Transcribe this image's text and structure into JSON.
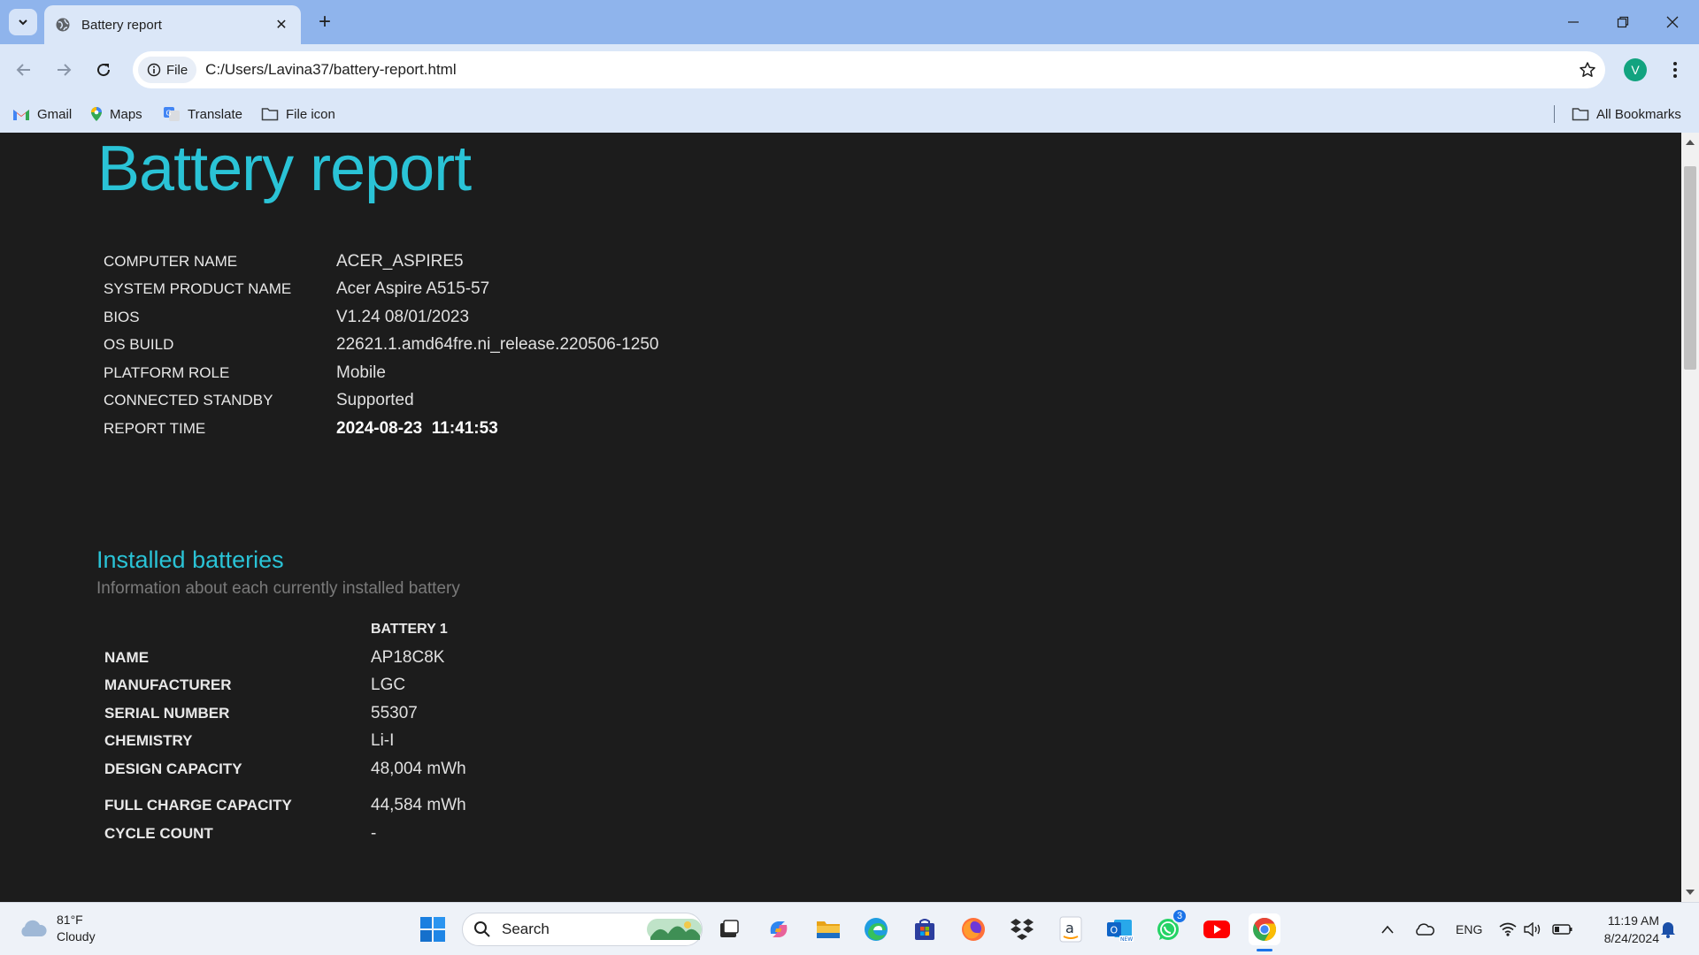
{
  "browser": {
    "tab_title": "Battery report",
    "file_chip": "File",
    "url": "C:/Users/Lavina37/battery-report.html",
    "profile_initial": "V",
    "bookmarks": [
      {
        "label": "Gmail",
        "icon": "gmail-icon"
      },
      {
        "label": "Maps",
        "icon": "maps-icon"
      },
      {
        "label": "Translate",
        "icon": "translate-icon"
      },
      {
        "label": "File icon",
        "icon": "folder-icon"
      }
    ],
    "all_bookmarks": "All Bookmarks"
  },
  "report": {
    "title": "Battery report",
    "system_info": [
      {
        "key": "COMPUTER NAME",
        "value": "ACER_ASPIRE5"
      },
      {
        "key": "SYSTEM PRODUCT NAME",
        "value": "Acer Aspire A515-57"
      },
      {
        "key": "BIOS",
        "value": "V1.24 08/01/2023"
      },
      {
        "key": "OS BUILD",
        "value": "22621.1.amd64fre.ni_release.220506-1250"
      },
      {
        "key": "PLATFORM ROLE",
        "value": "Mobile"
      },
      {
        "key": "CONNECTED STANDBY",
        "value": "Supported"
      },
      {
        "key": "REPORT TIME",
        "value": "2024-08-23  11:41:53"
      }
    ],
    "installed": {
      "heading": "Installed batteries",
      "subtitle": "Information about each currently installed battery",
      "column_header": "BATTERY 1",
      "rows": [
        {
          "key": "NAME",
          "value": "AP18C8K"
        },
        {
          "key": "MANUFACTURER",
          "value": "LGC"
        },
        {
          "key": "SERIAL NUMBER",
          "value": "55307"
        },
        {
          "key": "CHEMISTRY",
          "value": "Li-I"
        },
        {
          "key": "DESIGN CAPACITY",
          "value": "48,004 mWh"
        },
        {
          "key": "FULL CHARGE CAPACITY",
          "value": "44,584 mWh"
        },
        {
          "key": "CYCLE COUNT",
          "value": "-"
        }
      ]
    }
  },
  "taskbar": {
    "weather_temp": "81°F",
    "weather_desc": "Cloudy",
    "search_label": "Search",
    "whatsapp_badge": "3",
    "lang": "ENG",
    "time": "11:19 AM",
    "date": "8/24/2024"
  },
  "colors": {
    "accent": "#2ac3d6",
    "page_bg": "#1c1c1c",
    "chrome_frame": "#8fb4ec",
    "toolbar": "#dbe7f8"
  }
}
